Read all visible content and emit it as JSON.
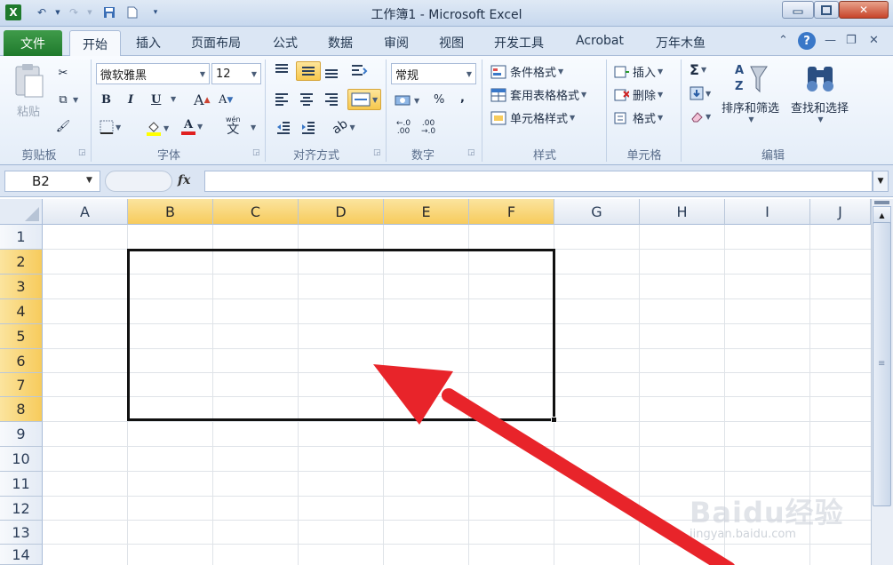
{
  "window": {
    "title": "工作簿1 - Microsoft Excel",
    "app_icon": "excel-x-icon"
  },
  "qat": {
    "items": [
      "excel-logo-icon",
      "undo-icon",
      "redo-icon",
      "save-icon",
      "new-doc-icon",
      "customize-qat-icon"
    ]
  },
  "tabs": {
    "file": "文件",
    "home": "开始",
    "items": [
      "插入",
      "页面布局",
      "公式",
      "数据",
      "审阅",
      "视图",
      "开发工具",
      "Acrobat",
      "万年木鱼"
    ]
  },
  "ribbon": {
    "clipboard": {
      "label": "剪贴板",
      "paste": "粘贴"
    },
    "font": {
      "label": "字体",
      "name": "微软雅黑",
      "size": "12",
      "bold": "B",
      "italic": "I",
      "underline": "U",
      "grow": "A",
      "shrink": "A",
      "color_letter": "A",
      "phonetic": "wén",
      "phonetic_char": "文"
    },
    "align": {
      "label": "对齐方式"
    },
    "number": {
      "label": "数字",
      "format": "常规",
      "percent": "%",
      "comma": ","
    },
    "styles": {
      "label": "样式",
      "conditional": "条件格式",
      "table": "套用表格格式",
      "cell_styles": "单元格样式"
    },
    "cells": {
      "label": "单元格",
      "insert": "插入",
      "delete": "删除",
      "format": "格式"
    },
    "edit": {
      "label": "编辑",
      "sigma": "Σ",
      "sort_filter": "排序和筛选",
      "find_select": "查找和选择"
    }
  },
  "formula_bar": {
    "name_box": "B2",
    "fx": "fx",
    "value": ""
  },
  "grid": {
    "columns": [
      "A",
      "B",
      "C",
      "D",
      "E",
      "F",
      "G",
      "H",
      "I",
      "J"
    ],
    "rows": [
      "1",
      "2",
      "3",
      "4",
      "5",
      "6",
      "7",
      "8",
      "9",
      "10",
      "11",
      "12",
      "13",
      "14"
    ],
    "selected_range": "B2:F8"
  },
  "colors": {
    "accent_green": "#1f7a2c",
    "selection_header": "#f7cb5c",
    "arrow_red": "#e8242a"
  },
  "watermark": {
    "logo": "Baidu经验",
    "url": "jingyan.baidu.com"
  }
}
